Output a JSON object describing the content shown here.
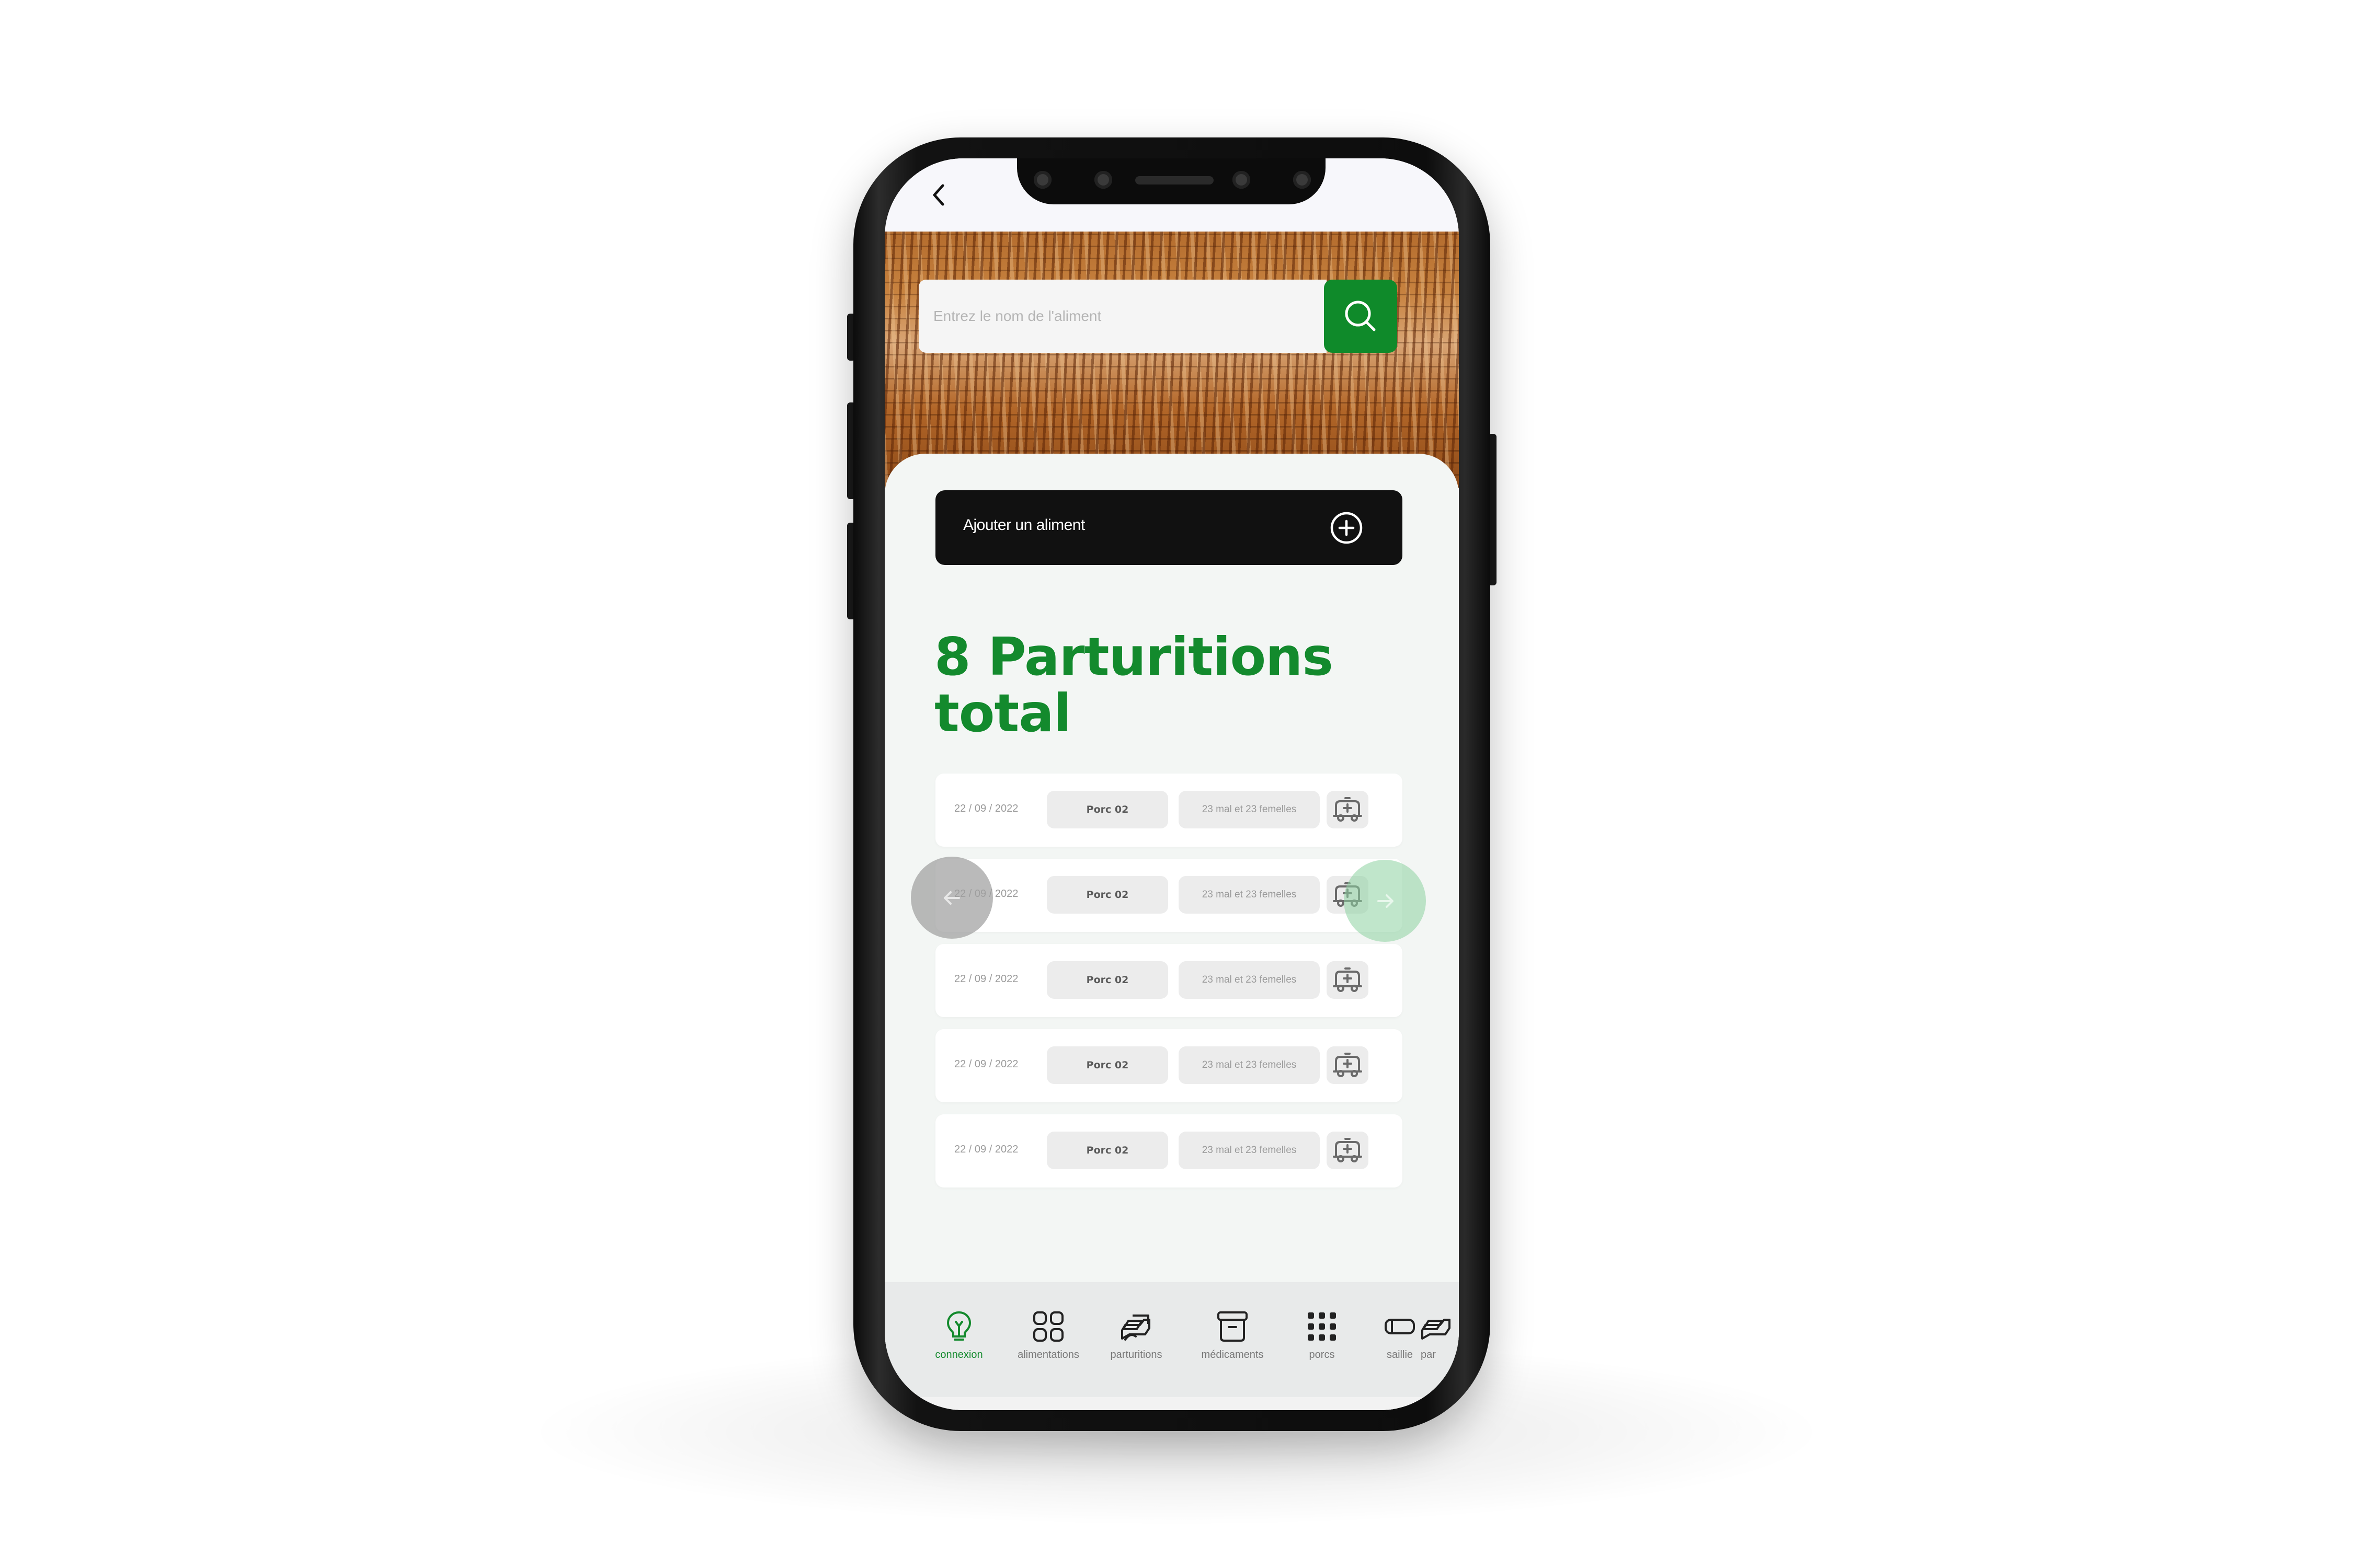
{
  "search": {
    "placeholder": "Entrez le nom de l'aliment"
  },
  "add_food": {
    "label": "Ajouter un aliment"
  },
  "page": {
    "title": "8 Parturitions total"
  },
  "rows": [
    {
      "date": "22 / 09 / 2022",
      "pig": "Porc 02",
      "count": "23 mal et 23 femelles"
    },
    {
      "date": "22 / 09 / 2022",
      "pig": "Porc 02",
      "count": "23 mal et 23 femelles"
    },
    {
      "date": "22 / 09 / 2022",
      "pig": "Porc 02",
      "count": "23 mal et 23 femelles"
    },
    {
      "date": "22 / 09 / 2022",
      "pig": "Porc 02",
      "count": "23 mal et 23 femelles"
    },
    {
      "date": "22 / 09 / 2022",
      "pig": "Porc 02",
      "count": "23 mal et 23 femelles"
    }
  ],
  "nav": {
    "items": [
      {
        "label": "connexion",
        "icon": "bulb-icon",
        "active": true
      },
      {
        "label": "alimentations",
        "icon": "grid-icon",
        "active": false
      },
      {
        "label": "parturitions",
        "icon": "cards-icon",
        "active": false
      },
      {
        "label": "médicaments",
        "icon": "archive-icon",
        "active": false
      },
      {
        "label": "porcs",
        "icon": "dots-grid-icon",
        "active": false
      },
      {
        "label": "saillie",
        "icon": "tag-icon",
        "active": false
      },
      {
        "label": "par",
        "icon": "cards-icon",
        "active": false
      }
    ]
  },
  "colors": {
    "accent": "#138a2d",
    "search_button": "#0f8a2a",
    "add_button": "#111111",
    "background": "#f3f6f4"
  }
}
